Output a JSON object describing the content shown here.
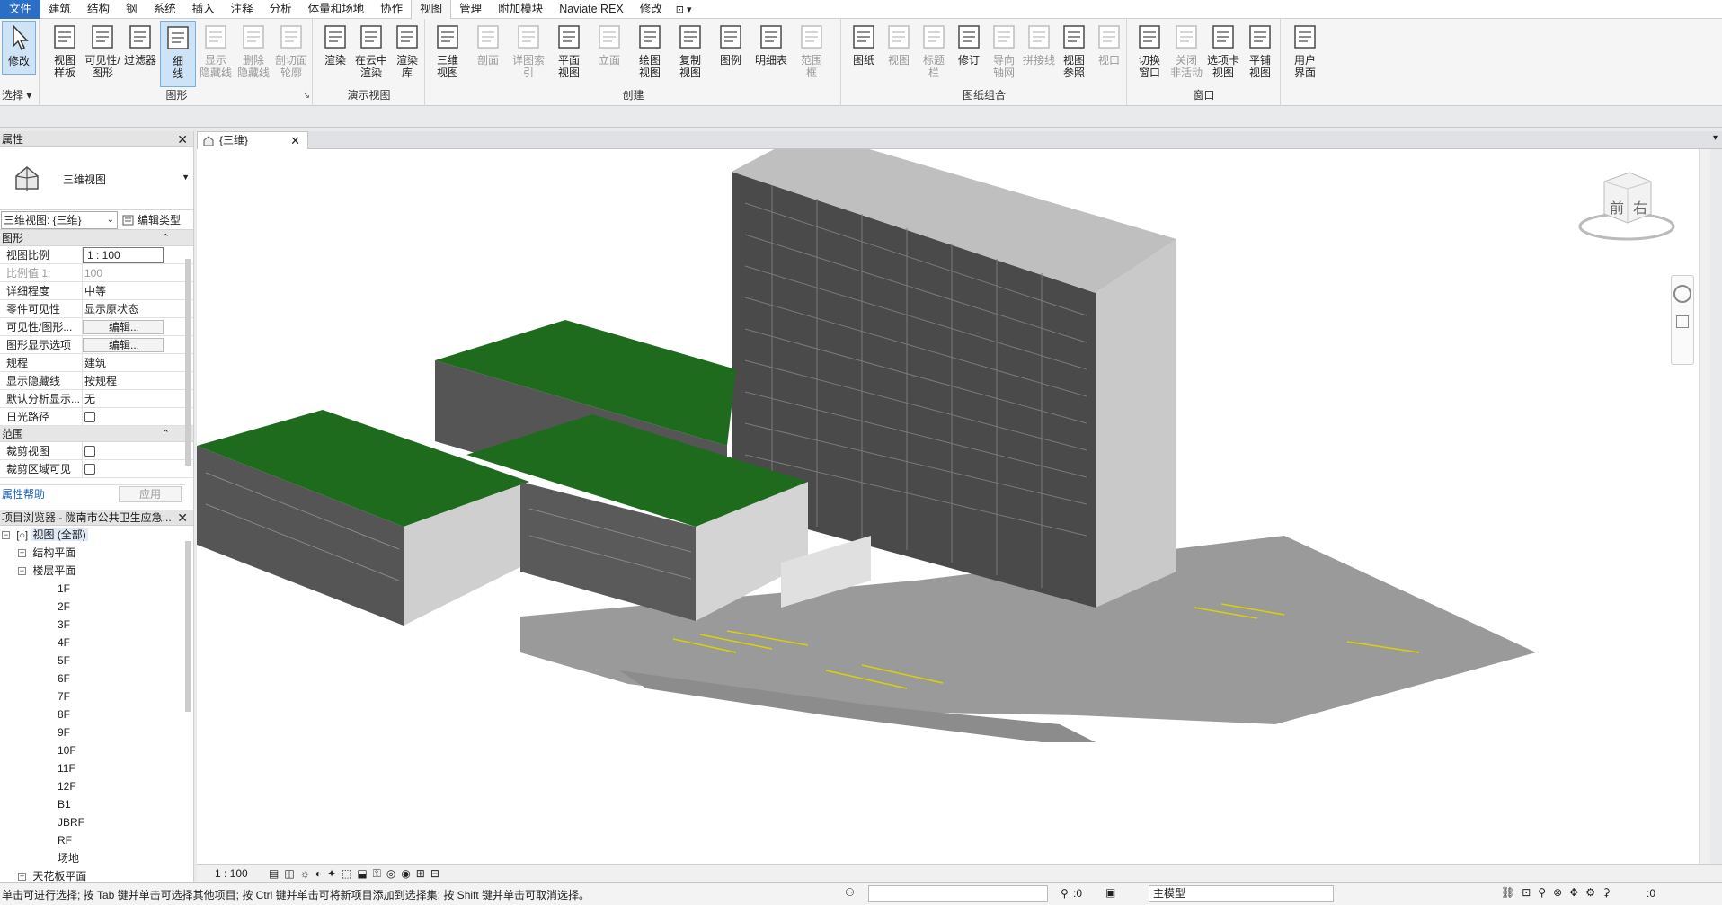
{
  "menu": {
    "tabs": [
      "文件",
      "建筑",
      "结构",
      "钢",
      "系统",
      "插入",
      "注释",
      "分析",
      "体量和场地",
      "协作",
      "视图",
      "管理",
      "附加模块",
      "Naviate REX",
      "修改"
    ],
    "active": "视图"
  },
  "ribbon": {
    "select": {
      "modify_label": "修改",
      "title": "选择"
    },
    "graphics": {
      "title": "图形",
      "buttons": [
        "视图\n样板",
        "可见性/\n图形",
        "过滤器",
        "细\n线",
        "显示\n隐藏线",
        "删除\n隐藏线",
        "剖切面\n轮廓"
      ]
    },
    "presentation": {
      "title": "演示视图",
      "buttons": [
        "渲染",
        "在云中\n渲染",
        "渲染\n库"
      ]
    },
    "create": {
      "title": "创建",
      "buttons": [
        "三维\n视图",
        "剖面",
        "详图索引",
        "平面\n视图",
        "立面",
        "绘图\n视图",
        "复制\n视图",
        "图例",
        "明细表",
        "范围\n框"
      ]
    },
    "sheet": {
      "title": "图纸组合",
      "buttons": [
        "图纸",
        "视图",
        "标题\n栏",
        "修订",
        "导向\n轴网",
        "拼接线",
        "视图\n参照",
        "视口"
      ]
    },
    "window": {
      "title": "窗口",
      "buttons": [
        "切换\n窗口",
        "关闭\n非活动",
        "选项卡\n视图",
        "平铺\n视图"
      ]
    },
    "ui": {
      "buttons": [
        "用户\n界面"
      ]
    }
  },
  "properties": {
    "header": "属性",
    "type_name": "三维视图",
    "view_selector": "三维视图: {三维}",
    "edit_type": "编辑类型",
    "cat_graphics": "图形",
    "rows": [
      {
        "k": "视图比例",
        "v": "1 : 100"
      },
      {
        "k": "比例值 1:",
        "v": "100"
      },
      {
        "k": "详细程度",
        "v": "中等"
      },
      {
        "k": "零件可见性",
        "v": "显示原状态"
      },
      {
        "k": "可见性/图形...",
        "v": "编辑..."
      },
      {
        "k": "图形显示选项",
        "v": "编辑..."
      },
      {
        "k": "规程",
        "v": "建筑"
      },
      {
        "k": "显示隐藏线",
        "v": "按规程"
      },
      {
        "k": "默认分析显示...",
        "v": "无"
      },
      {
        "k": "日光路径",
        "v": ""
      }
    ],
    "cat_extents": "范围",
    "rows2": [
      {
        "k": "裁剪视图",
        "v": ""
      },
      {
        "k": "裁剪区域可见",
        "v": ""
      }
    ],
    "help": "属性帮助",
    "apply": "应用"
  },
  "browser": {
    "header": "项目浏览器 - 陇南市公共卫生应急...",
    "root": "视图 (全部)",
    "struct": "结构平面",
    "floors": "楼层平面",
    "levels": [
      "1F",
      "2F",
      "3F",
      "4F",
      "5F",
      "6F",
      "7F",
      "8F",
      "9F",
      "10F",
      "11F",
      "12F",
      "B1",
      "JBRF",
      "RF",
      "场地"
    ],
    "ceiling": "天花板平面"
  },
  "view": {
    "tab": "{三维}",
    "scale": "1 : 100",
    "cube_front": "前",
    "cube_right": "右"
  },
  "status": {
    "hint": "单击可进行选择; 按 Tab 键并单击可选择其他项目; 按 Ctrl 键并单击可将新项目添加到选择集; 按 Shift 键并单击可取消选择。",
    "count1": ":0",
    "model": "主模型",
    "count2": ":0"
  }
}
